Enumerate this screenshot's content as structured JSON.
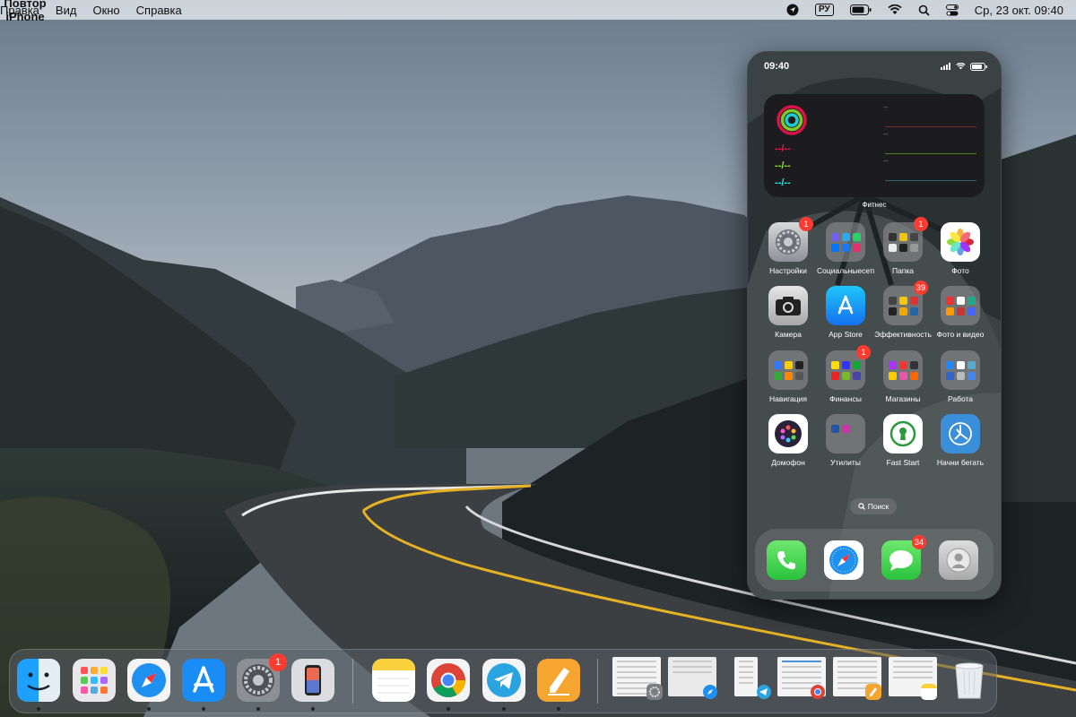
{
  "menubar": {
    "app_name": "Повтор iPhone",
    "menus": [
      "Правка",
      "Вид",
      "Окно",
      "Справка"
    ],
    "input_source": "РУ",
    "clock": "Ср, 23 окт.  09:40"
  },
  "phone": {
    "time": "09:40",
    "widget": {
      "label": "Фитнес",
      "rows": [
        "--/--",
        "--/--",
        "--/--"
      ],
      "chart_ticks": [
        "--",
        "--",
        "--"
      ]
    },
    "apps": [
      {
        "label": "Настройки",
        "badge": "1"
      },
      {
        "label": "Социальныесети",
        "badge": ""
      },
      {
        "label": "Папка",
        "badge": "1"
      },
      {
        "label": "Фото",
        "badge": ""
      },
      {
        "label": "Камера",
        "badge": ""
      },
      {
        "label": "App Store",
        "badge": ""
      },
      {
        "label": "Эффективность",
        "badge": "39"
      },
      {
        "label": "Фото и видео",
        "badge": ""
      },
      {
        "label": "Навигация",
        "badge": ""
      },
      {
        "label": "Финансы",
        "badge": "1"
      },
      {
        "label": "Магазины",
        "badge": ""
      },
      {
        "label": "Работа",
        "badge": ""
      },
      {
        "label": "Домофон",
        "badge": ""
      },
      {
        "label": "Утилиты",
        "badge": ""
      },
      {
        "label": "Fast Start",
        "badge": ""
      },
      {
        "label": "Начни бегать",
        "badge": ""
      }
    ],
    "search_label": "Поиск",
    "dock_badges": {
      "messages": "34"
    }
  },
  "dock": {
    "settings_badge": "1"
  },
  "colors": {
    "badge": "#ff3b30",
    "ring_move": "#fa114f",
    "ring_exercise": "#92e82a",
    "ring_stand": "#1eeaef"
  }
}
